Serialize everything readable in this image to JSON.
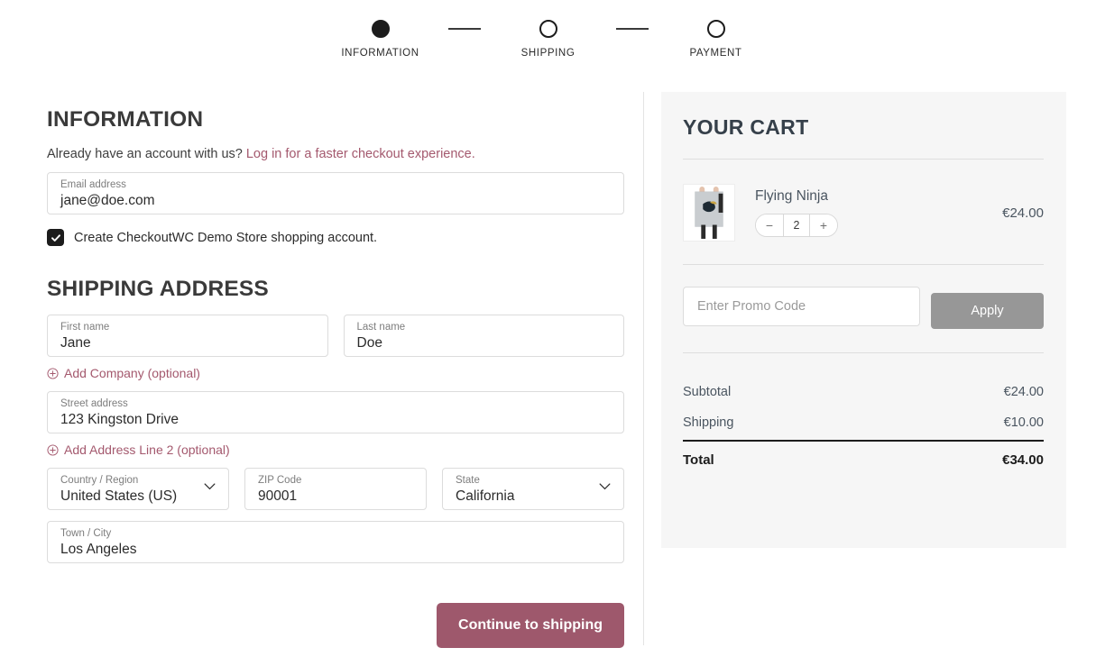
{
  "stepper": {
    "steps": [
      {
        "label": "INFORMATION",
        "state": "done"
      },
      {
        "label": "SHIPPING",
        "state": "pending"
      },
      {
        "label": "PAYMENT",
        "state": "pending"
      }
    ]
  },
  "information": {
    "heading": "INFORMATION",
    "account_prompt": "Already have an account with us?",
    "login_link": "Log in for a faster checkout experience.",
    "email": {
      "label": "Email address",
      "value": "jane@doe.com"
    },
    "create_account_label": "Create CheckoutWC Demo Store shopping account.",
    "create_account_checked": true
  },
  "shipping": {
    "heading": "SHIPPING ADDRESS",
    "first_name": {
      "label": "First name",
      "value": "Jane"
    },
    "last_name": {
      "label": "Last name",
      "value": "Doe"
    },
    "add_company_link": "Add Company (optional)",
    "street": {
      "label": "Street address",
      "value": "123 Kingston Drive"
    },
    "add_address2_link": "Add Address Line 2 (optional)",
    "country": {
      "label": "Country / Region",
      "value": "United States (US)"
    },
    "zip": {
      "label": "ZIP Code",
      "value": "90001"
    },
    "state": {
      "label": "State",
      "value": "California"
    },
    "city": {
      "label": "Town / City",
      "value": "Los Angeles"
    },
    "submit_label": "Continue to shipping"
  },
  "cart": {
    "title": "YOUR CART",
    "item": {
      "name": "Flying Ninja",
      "quantity": "2",
      "price": "€24.00",
      "decrease_label": "−",
      "increase_label": "+"
    },
    "promo": {
      "placeholder": "Enter Promo Code",
      "value": "",
      "apply_label": "Apply"
    },
    "totals": [
      {
        "label": "Subtotal",
        "value": "€24.00"
      },
      {
        "label": "Shipping",
        "value": "€10.00"
      }
    ],
    "grand_total": {
      "label": "Total",
      "value": "€34.00"
    }
  },
  "colors": {
    "accent": "#9e586c",
    "link": "#a4596e",
    "panel_bg": "#f6f6f6",
    "apply_button": "#979797",
    "step_active": "#1c1c1c"
  }
}
